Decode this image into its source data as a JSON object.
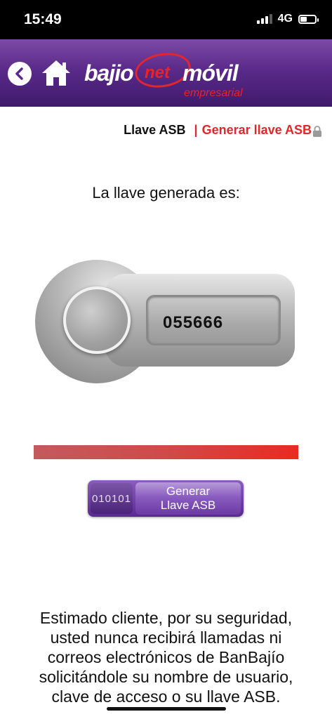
{
  "status_bar": {
    "time": "15:49",
    "network": "4G",
    "icons": [
      "signal-icon",
      "battery-icon"
    ]
  },
  "header": {
    "logo": {
      "bajio": "bajio",
      "net": "net",
      "movil": "móvil",
      "empresarial": "empresarial"
    },
    "icons": [
      "back-icon",
      "home-icon"
    ],
    "colors": {
      "header_purple": "#5a2a8a",
      "brand_red": "#e2262c"
    }
  },
  "tabs": {
    "llave": "Llave ASB",
    "separator": "|",
    "generar": "Generar llave ASB",
    "lock_icon": "lock-icon"
  },
  "main": {
    "subtitle": "La llave generada es:",
    "code": "055666",
    "progress": 1.0,
    "button": {
      "binary": "010101",
      "line1": "Generar",
      "line2": "Llave ASB"
    }
  },
  "notice": {
    "line1": "Estimado cliente, por su seguridad,",
    "line2": "usted nunca recibirá llamadas ni",
    "line3": "correos electrónicos de BanBajío",
    "line4": "solicitándole su nombre de usuario,",
    "line5": "clave de acceso o su llave ASB."
  }
}
